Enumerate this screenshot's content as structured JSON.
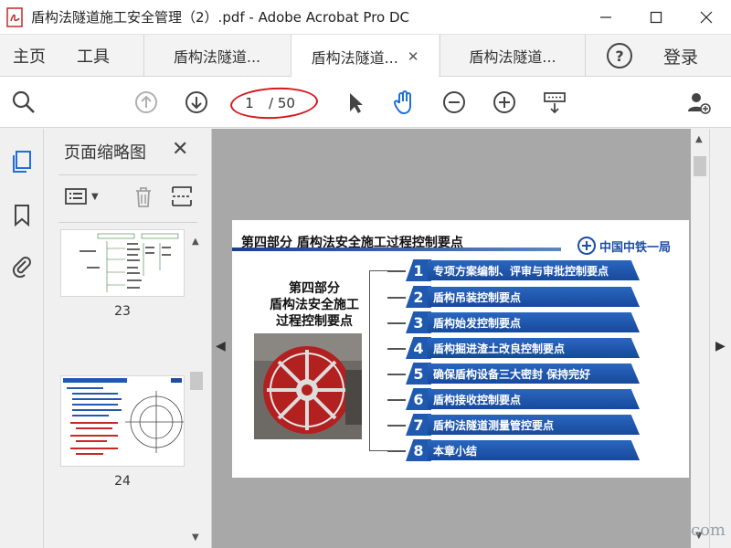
{
  "window": {
    "title": "盾构法隧道施工安全管理（2）.pdf - Adobe Acrobat Pro DC"
  },
  "tabs": {
    "home": "主页",
    "tools": "工具",
    "docs": [
      {
        "label": "盾构法隧道...",
        "active": false
      },
      {
        "label": "盾构法隧道...",
        "active": true
      },
      {
        "label": "盾构法隧道...",
        "active": false
      }
    ],
    "help": "?",
    "login": "登录"
  },
  "toolbar": {
    "page_current": "1",
    "page_total": "/ 50"
  },
  "thumbnails_panel": {
    "title": "页面缩略图",
    "pages": [
      {
        "number": "23"
      },
      {
        "number": "24"
      }
    ]
  },
  "slide": {
    "header": "第四部分  盾构法安全施工过程控制要点",
    "logo": "中国中铁一局",
    "left_title_line1": "第四部分",
    "left_title_line2": "盾构法安全施工",
    "left_title_line3": "过程控制要点",
    "items": [
      {
        "num": "1",
        "text": "专项方案编制、评审与审批控制要点"
      },
      {
        "num": "2",
        "text": "盾构吊装控制要点"
      },
      {
        "num": "3",
        "text": "盾构始发控制要点"
      },
      {
        "num": "4",
        "text": "盾构掘进渣土改良控制要点"
      },
      {
        "num": "5",
        "text": "确保盾构设备三大密封  保持完好"
      },
      {
        "num": "6",
        "text": "盾构接收控制要点"
      },
      {
        "num": "7",
        "text": "盾构法隧道测量管控要点"
      },
      {
        "num": "8",
        "text": "本章小结"
      }
    ]
  },
  "watermark": "com",
  "colors": {
    "accent_red": "#d4191f",
    "slide_blue": "#1f5ab0"
  }
}
